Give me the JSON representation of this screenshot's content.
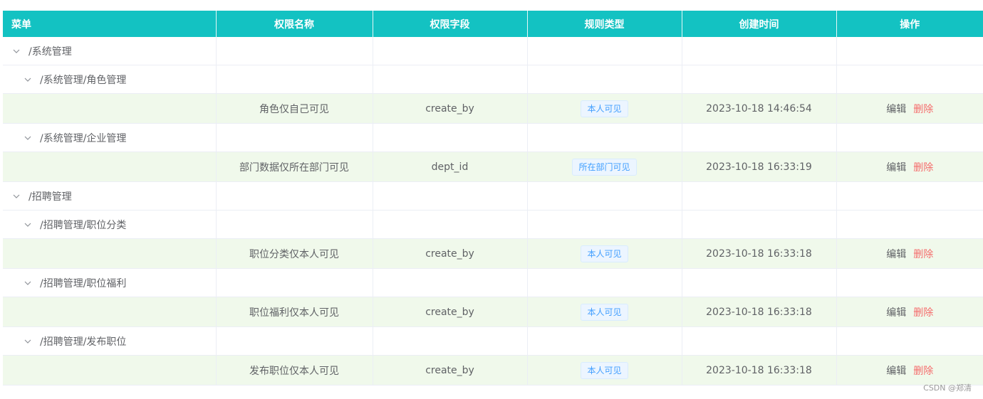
{
  "header": {
    "col_menu": "菜单",
    "col_name": "权限名称",
    "col_field": "权限字段",
    "col_type": "规则类型",
    "col_time": "创建时间",
    "col_action": "操作"
  },
  "rows": [
    {
      "kind": "group",
      "level": 0,
      "menu": "/系统管理"
    },
    {
      "kind": "group",
      "level": 1,
      "menu": "/系统管理/角色管理"
    },
    {
      "kind": "leaf",
      "name": "角色仅自己可见",
      "field": "create_by",
      "type": "本人可见",
      "time": "2023-10-18 14:46:54",
      "edit": "编辑",
      "del": "删除"
    },
    {
      "kind": "group",
      "level": 1,
      "menu": "/系统管理/企业管理"
    },
    {
      "kind": "leaf",
      "name": "部门数据仅所在部门可见",
      "field": "dept_id",
      "type": "所在部门可见",
      "time": "2023-10-18 16:33:19",
      "edit": "编辑",
      "del": "删除"
    },
    {
      "kind": "group",
      "level": 0,
      "menu": "/招聘管理"
    },
    {
      "kind": "group",
      "level": 1,
      "menu": "/招聘管理/职位分类"
    },
    {
      "kind": "leaf",
      "name": "职位分类仅本人可见",
      "field": "create_by",
      "type": "本人可见",
      "time": "2023-10-18 16:33:18",
      "edit": "编辑",
      "del": "删除"
    },
    {
      "kind": "group",
      "level": 1,
      "menu": "/招聘管理/职位福利"
    },
    {
      "kind": "leaf",
      "name": "职位福利仅本人可见",
      "field": "create_by",
      "type": "本人可见",
      "time": "2023-10-18 16:33:18",
      "edit": "编辑",
      "del": "删除"
    },
    {
      "kind": "group",
      "level": 1,
      "menu": "/招聘管理/发布职位"
    },
    {
      "kind": "leaf",
      "name": "发布职位仅本人可见",
      "field": "create_by",
      "type": "本人可见",
      "time": "2023-10-18 16:33:18",
      "edit": "编辑",
      "del": "删除"
    }
  ],
  "watermark": "CSDN @郑清",
  "colors": {
    "header_bg": "#13c2c2",
    "leaf_row_bg": "#f0f9eb",
    "tag": "#409eff",
    "delete": "#f56c6c"
  },
  "icons": {
    "expand": "chevron-down-icon"
  }
}
